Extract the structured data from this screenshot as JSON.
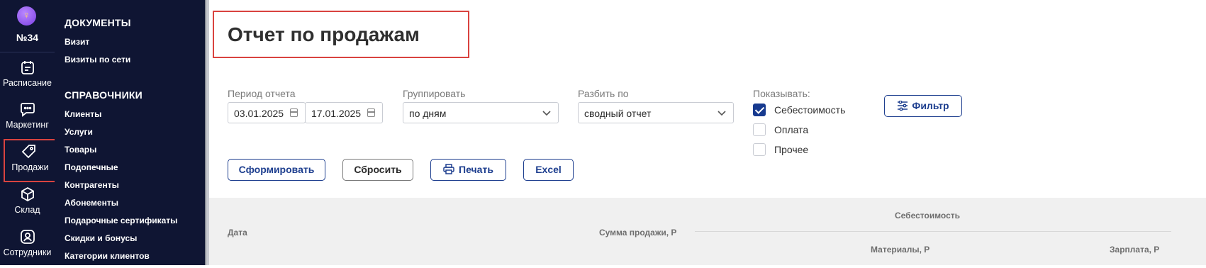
{
  "rail": {
    "logo_glyph": "♀",
    "branch": "№34",
    "items": [
      {
        "label": "Расписание",
        "icon": "calendar-icon"
      },
      {
        "label": "Маркетинг",
        "icon": "chat-icon"
      },
      {
        "label": "Продажи",
        "icon": "tag-icon"
      },
      {
        "label": "Склад",
        "icon": "box-icon"
      },
      {
        "label": "Сотрудники",
        "icon": "user-icon"
      }
    ]
  },
  "menu": {
    "documents_title": "ДОКУМЕНТЫ",
    "documents": [
      "Визит",
      "Визиты по сети"
    ],
    "references_title": "СПРАВОЧНИКИ",
    "references": [
      "Клиенты",
      "Услуги",
      "Товары",
      "Подопечные",
      "Контрагенты",
      "Абонементы",
      "Подарочные сертификаты",
      "Скидки и бонусы",
      "Категории клиентов"
    ]
  },
  "page": {
    "title": "Отчет по продажам"
  },
  "filters": {
    "period_label": "Период отчета",
    "date_from": "03.01.2025",
    "date_to": "17.01.2025",
    "group_label": "Группировать",
    "group_value": "по дням",
    "split_label": "Разбить по",
    "split_value": "сводный отчет",
    "show_label": "Показывать:",
    "show_options": [
      {
        "label": "Себестоимость",
        "checked": true
      },
      {
        "label": "Оплата",
        "checked": false
      },
      {
        "label": "Прочее",
        "checked": false
      }
    ],
    "filter_button": "Фильтр"
  },
  "actions": {
    "generate": "Сформировать",
    "reset": "Сбросить",
    "print": "Печать",
    "excel": "Excel"
  },
  "table": {
    "col_date": "Дата",
    "col_sales": "Сумма продажи, Р",
    "group_cost": "Себестоимость",
    "col_materials": "Материалы, Р",
    "col_salary": "Зарплата, Р"
  },
  "colors": {
    "sidebar": "#0f1533",
    "accent": "#1e3f8f",
    "highlight": "#d9433f"
  }
}
